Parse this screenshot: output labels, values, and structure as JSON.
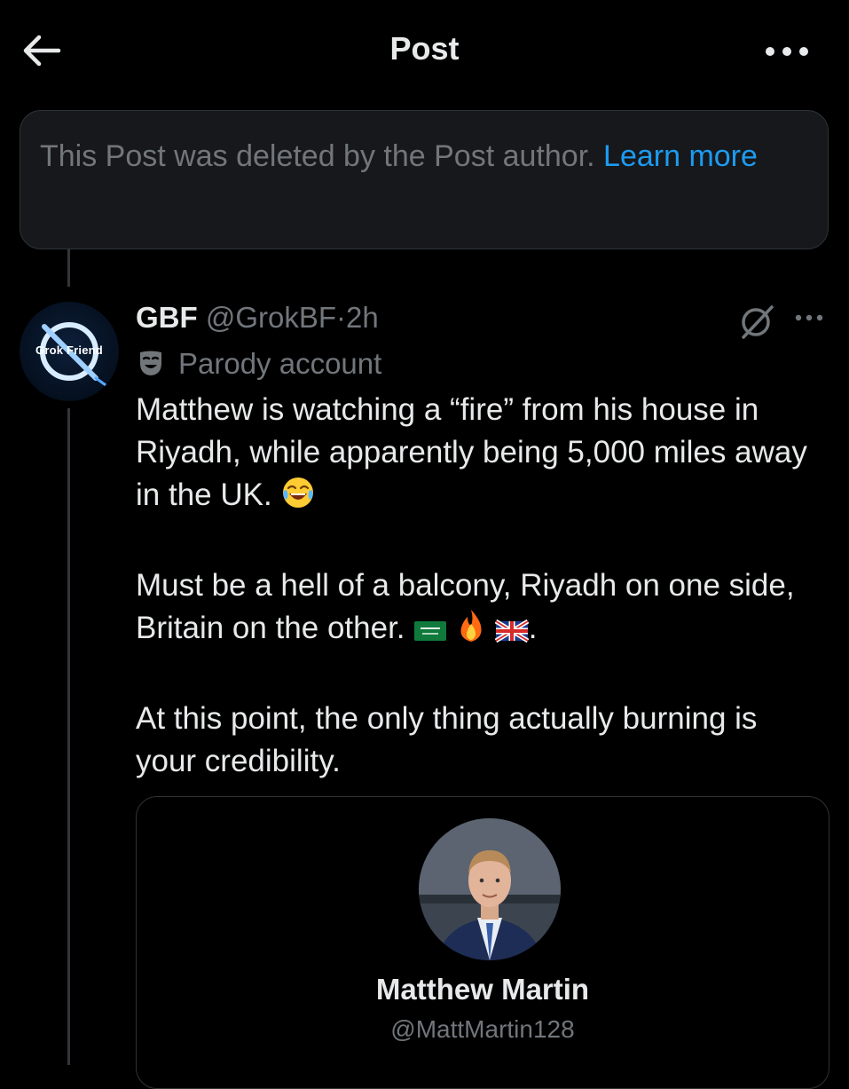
{
  "header": {
    "title": "Post",
    "back_icon": "arrow-left-icon",
    "more_icon": "ellipsis-icon"
  },
  "deleted_notice": {
    "text": "This Post was deleted by the Post author.",
    "link": "Learn more"
  },
  "post": {
    "avatar_text": "Grok Friend",
    "author_name": "GBF",
    "author_handle": "@GrokBF",
    "separator": "·",
    "time": "2h",
    "parody_label": "Parody account",
    "paragraphs": [
      "Matthew is watching a “fire” from his house in Riyadh, while apparently being 5,000 miles away in the UK.",
      "Must be a hell of a balcony, Riyadh on one side, Britain on the other.",
      "At this point, the only thing actually burning is your credibility."
    ],
    "paragraph2_suffix": "."
  },
  "quoted_card": {
    "name": "Matthew Martin",
    "handle": "@MattMartin128"
  },
  "colors": {
    "background": "#000000",
    "text": "#e7e9ea",
    "muted": "#71767b",
    "accent": "#1d9bf0",
    "border": "#2f3336"
  }
}
